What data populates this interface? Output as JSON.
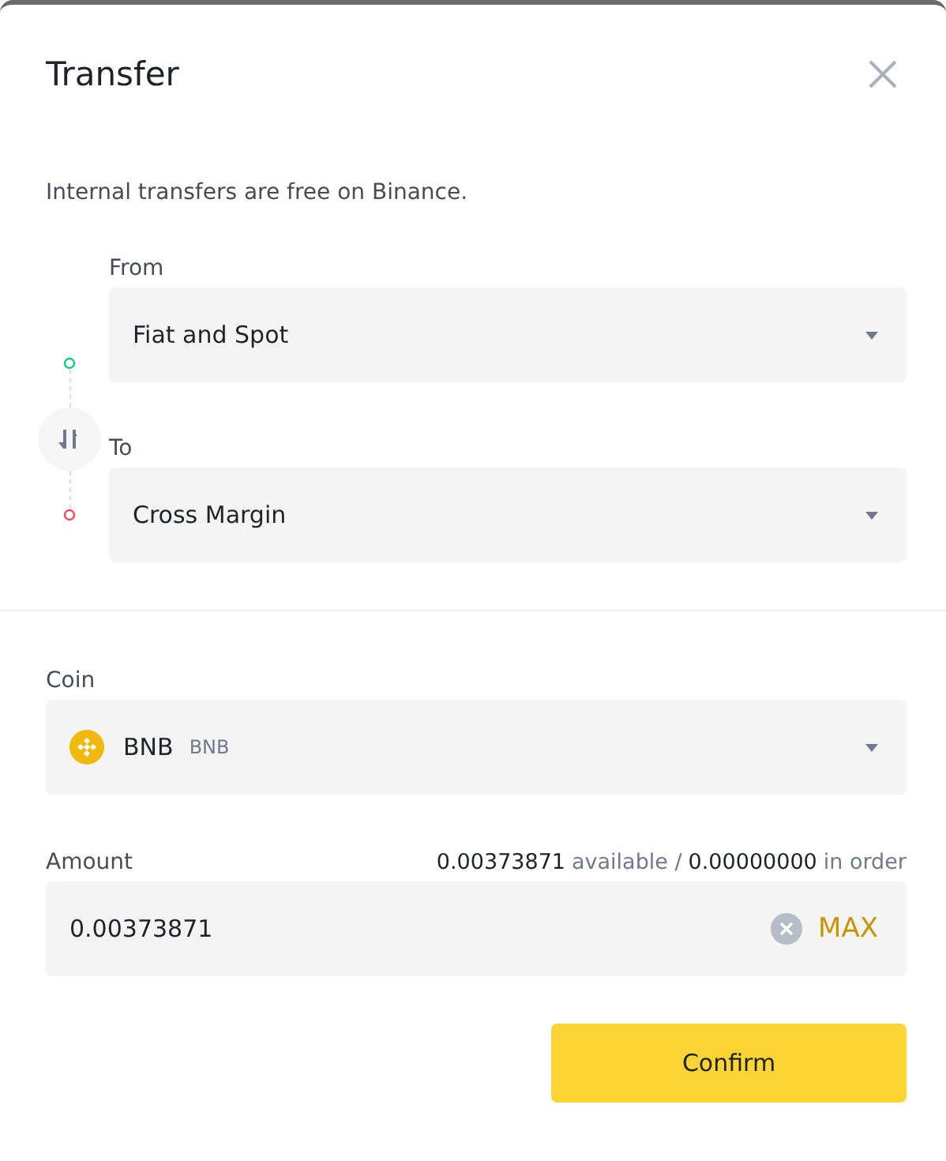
{
  "dialog": {
    "title": "Transfer",
    "note": "Internal transfers are free on Binance."
  },
  "from": {
    "label": "From",
    "value": "Fiat and Spot"
  },
  "to": {
    "label": "To",
    "value": "Cross Margin"
  },
  "coin": {
    "label": "Coin",
    "name": "BNB",
    "symbol": "BNB"
  },
  "amount": {
    "label": "Amount",
    "available_value": "0.00373871",
    "available_label": "available /",
    "in_order_value": "0.00000000",
    "in_order_label": "in order",
    "value": "0.00373871",
    "max_label": "MAX"
  },
  "buttons": [
    {
      "label": "Confirm",
      "kind": "primary"
    }
  ]
}
